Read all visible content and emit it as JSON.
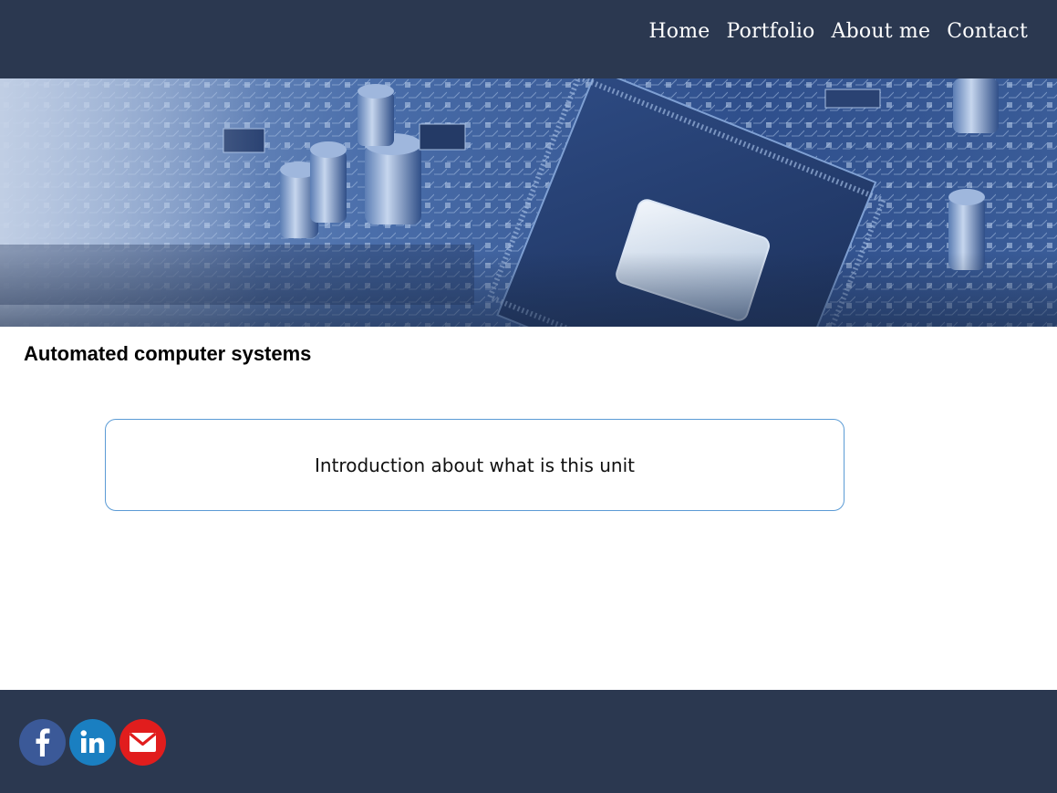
{
  "nav": {
    "items": [
      {
        "label": "Home"
      },
      {
        "label": "Portfolio"
      },
      {
        "label": "About me"
      },
      {
        "label": "Contact"
      }
    ]
  },
  "hero": {
    "image": "circuit-board-banner"
  },
  "main": {
    "title": "Automated computer systems",
    "intro": "Introduction about what is this unit"
  },
  "footer": {
    "social": [
      {
        "icon": "facebook-icon",
        "color": "#3b5998"
      },
      {
        "icon": "linkedin-icon",
        "color": "#1a7fc1"
      },
      {
        "icon": "email-icon",
        "color": "#e11d1d"
      }
    ]
  },
  "colors": {
    "header_bg": "#2b3850",
    "footer_bg": "#2b3850",
    "box_border": "#5b9bd5"
  }
}
